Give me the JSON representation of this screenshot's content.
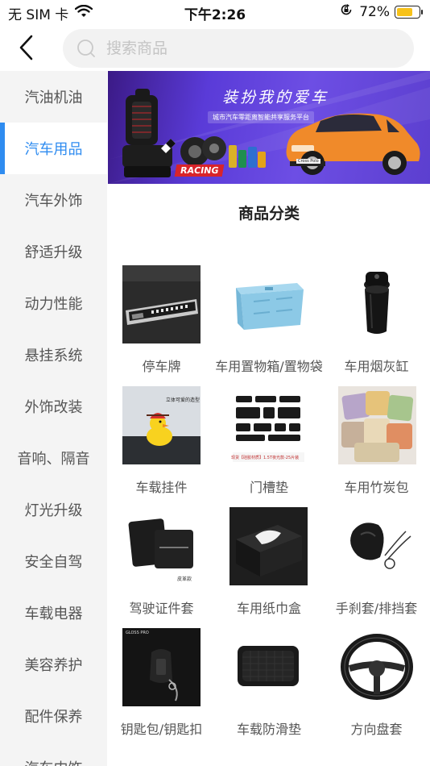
{
  "status_bar": {
    "carrier": "无 SIM 卡",
    "time": "下午2:26",
    "battery": "72%",
    "battery_level": 0.72,
    "battery_color": "#f7c21a"
  },
  "search": {
    "placeholder": "搜索商品"
  },
  "sidebar": {
    "active_color": "#2f8cf0",
    "items": [
      {
        "label": "汽油机油"
      },
      {
        "label": "汽车用品"
      },
      {
        "label": "汽车外饰"
      },
      {
        "label": "舒适升级"
      },
      {
        "label": "动力性能"
      },
      {
        "label": "悬挂系统"
      },
      {
        "label": "外饰改装"
      },
      {
        "label": "音响、隔音"
      },
      {
        "label": "灯光升级"
      },
      {
        "label": "安全自驾"
      },
      {
        "label": "车载电器"
      },
      {
        "label": "美容养护"
      },
      {
        "label": "配件保养"
      },
      {
        "label": "汽车内饰"
      }
    ]
  },
  "banner": {
    "title": "装扮我的爱车",
    "subtitle": "城市汽车零距离智能共享服务平台",
    "racing": "RACING",
    "car_badge": "Cross Polo"
  },
  "section_title": "商品分类",
  "categories": [
    {
      "label": "停车牌",
      "icon": "parking-number-plate"
    },
    {
      "label": "车用置物箱/置物袋",
      "icon": "storage-box"
    },
    {
      "label": "车用烟灰缸",
      "icon": "ashtray"
    },
    {
      "label": "车载挂件",
      "icon": "duck-ornament",
      "image_text": "立体可爱的造型"
    },
    {
      "label": "门槽垫",
      "icon": "door-slot-mats",
      "image_text": "现货【硅胶材质】1.5T夜光款-25片装"
    },
    {
      "label": "车用竹炭包",
      "icon": "charcoal-pillows"
    },
    {
      "label": "驾驶证件套",
      "icon": "license-wallet",
      "image_text": "皮革款"
    },
    {
      "label": "车用纸巾盒",
      "icon": "tissue-box"
    },
    {
      "label": "手刹套/排挡套",
      "icon": "gear-cover"
    },
    {
      "label": "钥匙包/钥匙扣",
      "icon": "key-case",
      "image_text": "GLOSS PRO"
    },
    {
      "label": "车载防滑垫",
      "icon": "non-slip-mat"
    },
    {
      "label": "方向盘套",
      "icon": "steering-wheel-cover"
    }
  ]
}
